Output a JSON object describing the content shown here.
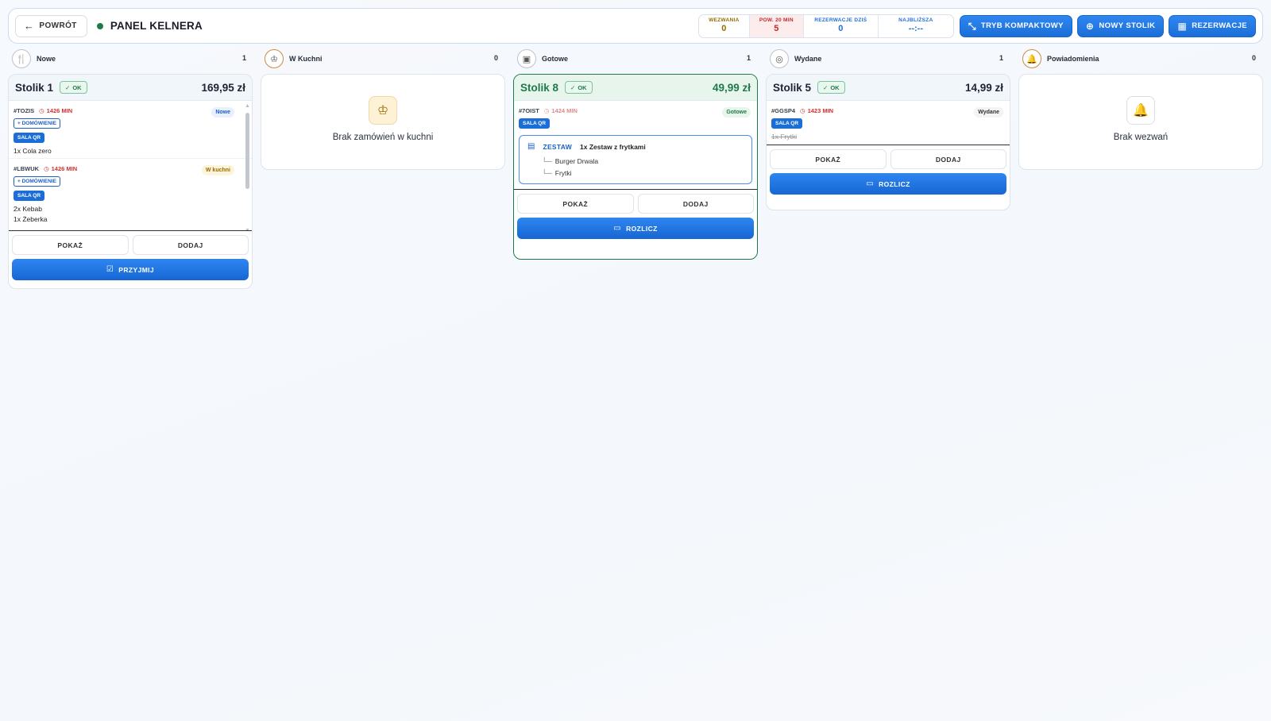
{
  "header": {
    "back_label": "POWRÓT",
    "title": "PANEL KELNERA",
    "stats": [
      {
        "label": "WEZWANIA",
        "value": "0"
      },
      {
        "label": "POW. 20 MIN",
        "value": "5"
      },
      {
        "label": "REZERWACJE DZIŚ",
        "value": "0"
      },
      {
        "label": "NAJBLIŻSZA",
        "value": "--:--"
      }
    ],
    "buttons": {
      "compact": "TRYB KOMPAKTOWY",
      "new_table": "NOWY STOLIK",
      "reservations": "REZERWACJE"
    }
  },
  "columns": [
    {
      "label": "Nowe",
      "count": "1"
    },
    {
      "label": "W Kuchni",
      "count": "0"
    },
    {
      "label": "Gotowe",
      "count": "1"
    },
    {
      "label": "Wydane",
      "count": "1"
    },
    {
      "label": "Powiadomienia",
      "count": "0"
    }
  ],
  "common": {
    "ok": "OK",
    "show": "POKAŻ",
    "add": "DODAJ",
    "accept": "PRZYJMIJ",
    "settle": "ROZLICZ",
    "delivery_tag": "+ DOMÓWIENIE",
    "qr_tag": "SALA QR"
  },
  "cards": {
    "new": {
      "table": "Stolik 1",
      "total": "169,95 zł",
      "orders": [
        {
          "id": "#TOZIS",
          "time": "1426 MIN",
          "status": "Nowe",
          "items": [
            "1x Cola zero"
          ]
        },
        {
          "id": "#LBWUK",
          "time": "1426 MIN",
          "status": "W kuchni",
          "items": [
            "2x Kebab",
            "1x Żeberka"
          ]
        }
      ]
    },
    "ready": {
      "table": "Stolik 8",
      "total": "49,99 zł",
      "order": {
        "id": "#7OIST",
        "time": "1424 MIN",
        "status": "Gotowe"
      },
      "set": {
        "tag": "ZESTAW",
        "name": "1x Zestaw z frytkami",
        "items": [
          "Burger Drwala",
          "Frytki"
        ]
      }
    },
    "served": {
      "table": "Stolik 5",
      "total": "14,99 zł",
      "order": {
        "id": "#GGSP4",
        "time": "1423 MIN",
        "status": "Wydane",
        "items": [
          "1x Frytki"
        ]
      }
    }
  },
  "empty": {
    "kitchen": "Brak zamówień w kuchni",
    "notifications": "Brak wezwań"
  }
}
